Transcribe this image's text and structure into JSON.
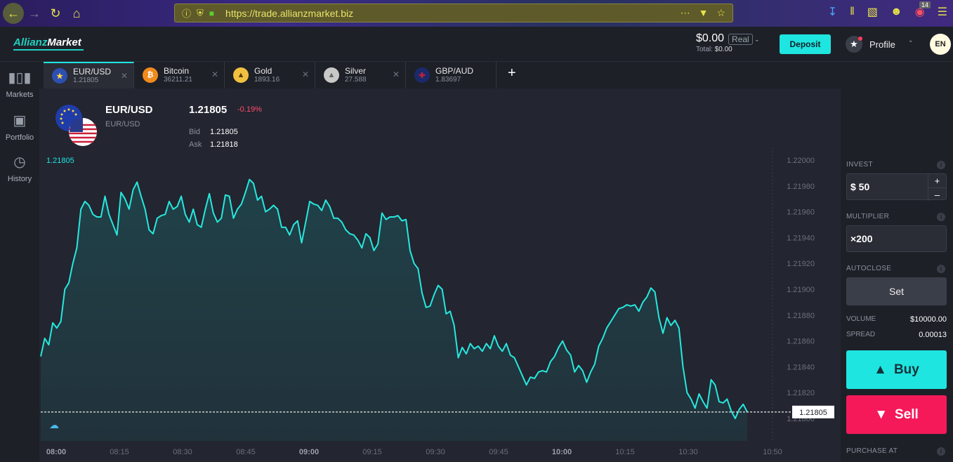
{
  "browser": {
    "url": "https://trade.allianzmarket.biz",
    "notification_count": "14"
  },
  "header": {
    "logo_a": "Allianz",
    "logo_m": "Market",
    "balance": "$0.00",
    "account_type": "Real",
    "total_label": "Total:",
    "total_value": "$0.00",
    "deposit_label": "Deposit",
    "profile_label": "Profile",
    "language": "EN"
  },
  "sidebar": {
    "items": [
      {
        "label": "Markets",
        "icon": "candlestick-icon"
      },
      {
        "label": "Portfolio",
        "icon": "briefcase-icon"
      },
      {
        "label": "History",
        "icon": "clock-icon"
      }
    ]
  },
  "tabs": [
    {
      "name": "EUR/USD",
      "price": "1.21805",
      "icon": "eu-us-flag-icon",
      "color": "#2d4fb0"
    },
    {
      "name": "Bitcoin",
      "price": "36211.21",
      "icon": "bitcoin-icon",
      "color": "#f08a1c"
    },
    {
      "name": "Gold",
      "price": "1893.16",
      "icon": "gold-icon",
      "color": "#f0c040"
    },
    {
      "name": "Silver",
      "price": "27.588",
      "icon": "silver-icon",
      "color": "#c8c8c8"
    },
    {
      "name": "GBP/AUD",
      "price": "1.83697",
      "icon": "gb-au-flag-icon",
      "color": "#c0203a"
    }
  ],
  "instrument": {
    "title": "EUR/USD",
    "subtitle": "EUR/USD",
    "price": "1.21805",
    "change": "-0.19%",
    "bid_label": "Bid",
    "bid": "1.21805",
    "ask_label": "Ask",
    "ask": "1.21818",
    "current_label": "1.21805"
  },
  "right_panel": {
    "invest_label": "INVEST",
    "invest_value": "$ 50",
    "plus": "+",
    "minus": "–",
    "multiplier_label": "MULTIPLIER",
    "multiplier_value": "×200",
    "autoclose_label": "AUTOCLOSE",
    "set_label": "Set",
    "volume_label": "VOLUME",
    "volume_value": "$10000.00",
    "spread_label": "SPREAD",
    "spread_value": "0.00013",
    "buy_label": "Buy",
    "sell_label": "Sell",
    "purchase_label": "PURCHASE AT"
  },
  "chart_data": {
    "type": "area",
    "current_price": 1.21805,
    "current_price_label": "1.21805",
    "ylim": [
      1.218,
      1.2201
    ],
    "y_ticks": [
      "1.22000",
      "1.21980",
      "1.21960",
      "1.21940",
      "1.21920",
      "1.21900",
      "1.21880",
      "1.21860",
      "1.21840",
      "1.21820",
      "1.21800"
    ],
    "x_ticks": [
      {
        "label": "08:00",
        "bold": true
      },
      {
        "label": "08:15",
        "bold": false
      },
      {
        "label": "08:30",
        "bold": false
      },
      {
        "label": "08:45",
        "bold": false
      },
      {
        "label": "09:00",
        "bold": true
      },
      {
        "label": "09:15",
        "bold": false
      },
      {
        "label": "09:30",
        "bold": false
      },
      {
        "label": "09:45",
        "bold": false
      },
      {
        "label": "10:00",
        "bold": true
      },
      {
        "label": "10:15",
        "bold": false
      },
      {
        "label": "10:30",
        "bold": false
      },
      {
        "label": "10:50",
        "bold": false
      }
    ],
    "series": [
      {
        "values": [
          1.21848,
          1.21862,
          1.21857,
          1.21874,
          1.2187,
          1.21875,
          1.219,
          1.21905,
          1.2192,
          1.21932,
          1.21962,
          1.21968,
          1.21965,
          1.21958,
          1.21956,
          1.21956,
          1.21972,
          1.21958,
          1.2195,
          1.21942,
          1.21975,
          1.2197,
          1.21962,
          1.21977,
          1.21983,
          1.21972,
          1.21962,
          1.21946,
          1.21943,
          1.21955,
          1.21957,
          1.21958,
          1.21968,
          1.21962,
          1.21964,
          1.21972,
          1.21958,
          1.21952,
          1.21962,
          1.2195,
          1.21948,
          1.21962,
          1.21974,
          1.21959,
          1.21952,
          1.21955,
          1.21973,
          1.21972,
          1.21955,
          1.21962,
          1.21966,
          1.21975,
          1.21985,
          1.21982,
          1.21969,
          1.21972,
          1.2196,
          1.21962,
          1.21965,
          1.21962,
          1.21948,
          1.21948,
          1.21942,
          1.2195,
          1.21953,
          1.21936,
          1.21952,
          1.21968,
          1.21966,
          1.21965,
          1.21961,
          1.21969,
          1.21964,
          1.21955,
          1.21955,
          1.21952,
          1.21946,
          1.21943,
          1.21942,
          1.21938,
          1.21932,
          1.21943,
          1.2194,
          1.2193,
          1.21935,
          1.21959,
          1.21954,
          1.21956,
          1.21956,
          1.21957,
          1.21953,
          1.21954,
          1.2193,
          1.2192,
          1.21916,
          1.21897,
          1.21886,
          1.21887,
          1.21896,
          1.21903,
          1.219,
          1.21881,
          1.21883,
          1.21872,
          1.21847,
          1.21855,
          1.2185,
          1.21858,
          1.21854,
          1.21856,
          1.21852,
          1.21858,
          1.21854,
          1.21864,
          1.21856,
          1.21852,
          1.21858,
          1.21849,
          1.21847,
          1.2184,
          1.21833,
          1.21826,
          1.21832,
          1.21831,
          1.21836,
          1.21837,
          1.21836,
          1.21844,
          1.21848,
          1.21855,
          1.2186,
          1.21853,
          1.21849,
          1.21836,
          1.21841,
          1.21837,
          1.21828,
          1.21836,
          1.21842,
          1.21856,
          1.21862,
          1.2187,
          1.21875,
          1.2188,
          1.21885,
          1.21886,
          1.21888,
          1.21887,
          1.21888,
          1.21883,
          1.2189,
          1.21894,
          1.21901,
          1.21898,
          1.21878,
          1.21866,
          1.21878,
          1.21872,
          1.21876,
          1.2187,
          1.2184,
          1.2182,
          1.21815,
          1.21808,
          1.21819,
          1.21813,
          1.21808,
          1.2183,
          1.21826,
          1.21813,
          1.21812,
          1.21815,
          1.21806,
          1.218,
          1.21807,
          1.21811,
          1.21805
        ]
      }
    ]
  }
}
